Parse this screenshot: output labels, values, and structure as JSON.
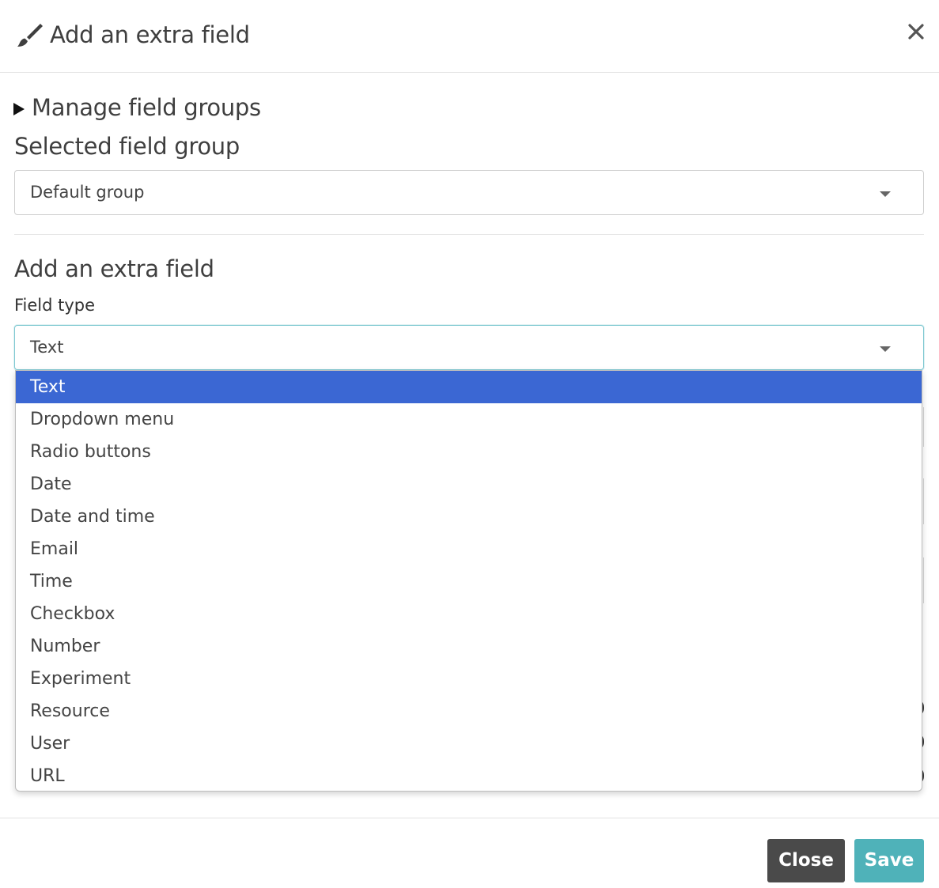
{
  "header": {
    "title": "Add an extra field",
    "icon": "pencil-brush-icon",
    "close_icon": "close-icon"
  },
  "manage_groups": {
    "label": "Manage field groups",
    "icon": "triangle-right-icon"
  },
  "selected_group": {
    "title": "Selected field group",
    "value": "Default group"
  },
  "extra_field": {
    "title": "Add an extra field",
    "field_type_label": "Field type",
    "field_type_value": "Text",
    "options": [
      {
        "label": "Text",
        "selected": true
      },
      {
        "label": "Dropdown menu",
        "selected": false
      },
      {
        "label": "Radio buttons",
        "selected": false
      },
      {
        "label": "Date",
        "selected": false
      },
      {
        "label": "Date and time",
        "selected": false
      },
      {
        "label": "Email",
        "selected": false
      },
      {
        "label": "Time",
        "selected": false
      },
      {
        "label": "Checkbox",
        "selected": false
      },
      {
        "label": "Number",
        "selected": false
      },
      {
        "label": "Experiment",
        "selected": false
      },
      {
        "label": "Resource",
        "selected": false
      },
      {
        "label": "User",
        "selected": false
      },
      {
        "label": "URL",
        "selected": false
      }
    ]
  },
  "footer": {
    "close_label": "Close",
    "save_label": "Save"
  },
  "colors": {
    "selected_option": "#3b67d3",
    "save_button": "#4fb2b9",
    "close_button": "#4a4a4a",
    "focus_border": "#7ec8d1"
  }
}
